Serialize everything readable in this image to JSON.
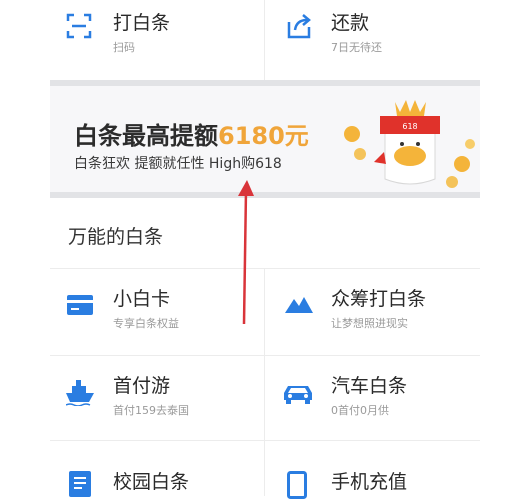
{
  "top_row": [
    {
      "title": "打白条",
      "subtitle": "扫码",
      "icon": "scan-icon"
    },
    {
      "title": "还款",
      "subtitle": "7日无待还",
      "icon": "repay-share-icon"
    }
  ],
  "banner": {
    "title_prefix": "白条最高提额",
    "title_amount": "6180元",
    "subtitle": "白条狂欢 提额就任性 High购618",
    "mascot_badge": "618",
    "colors": {
      "amount": "#f0a53a",
      "mascot_red": "#e0322b",
      "coin": "#f4b43a"
    }
  },
  "section": {
    "title": "万能的白条"
  },
  "grid": [
    {
      "title": "小白卡",
      "subtitle": "专享白条权益",
      "icon": "card-icon"
    },
    {
      "title": "众筹打白条",
      "subtitle": "让梦想照进现实",
      "icon": "mountain-icon"
    },
    {
      "title": "首付游",
      "subtitle": "首付159去泰国",
      "icon": "ship-icon"
    },
    {
      "title": "汽车白条",
      "subtitle": "0首付0月供",
      "icon": "car-icon"
    },
    {
      "title": "校园白条",
      "subtitle": "",
      "icon": "document-icon"
    },
    {
      "title": "手机充值",
      "subtitle": "",
      "icon": "phone-icon"
    }
  ],
  "colors": {
    "accent_blue": "#2a7de1",
    "annotation_red": "#d9343a"
  }
}
